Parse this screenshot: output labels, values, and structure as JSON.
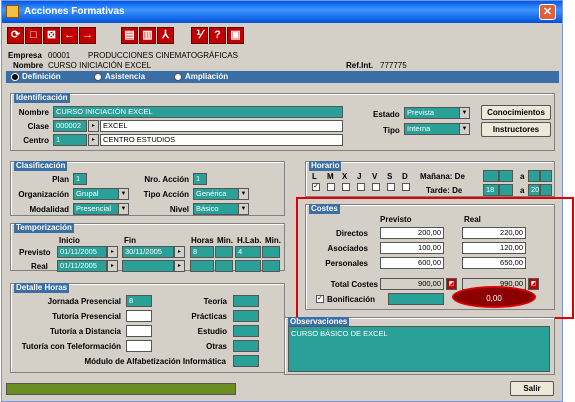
{
  "window": {
    "title": "Acciones Formativas"
  },
  "toolbar": [
    "⟳",
    "□",
    "⊠",
    "←",
    "→",
    "▤",
    "▥",
    "⅄",
    "⅟",
    "?",
    "▣"
  ],
  "header": {
    "empresa_label": "Empresa",
    "empresa_code": "00001",
    "empresa_name": "PRODUCCIONES CINEMATOGRÁFICAS",
    "nombre_label": "Nombre",
    "nombre_value": "CURSO INICIACIÓN EXCEL",
    "ref_label": "Ref.Int.",
    "ref_value": "777775"
  },
  "tabs": [
    "Definición",
    "Asistencia",
    "Ampliación"
  ],
  "identificacion": {
    "title": "Identificación",
    "nombre_label": "Nombre",
    "nombre": "CURSO INICIACIÓN EXCEL",
    "clase_label": "Clase",
    "clase_code": "000002",
    "clase_name": "EXCEL",
    "centro_label": "Centro",
    "centro_code": "1",
    "centro_name": "CENTRO ESTUDIOS",
    "estado_label": "Estado",
    "estado": "Prevista",
    "tipo_label": "Tipo",
    "tipo": "Interna",
    "btn_conocimientos": "Conocimientos",
    "btn_instructores": "Instructores"
  },
  "clasificacion": {
    "title": "Clasificación",
    "plan_label": "Plan",
    "plan": "1",
    "nro_label": "Nro. Acción",
    "nro": "1",
    "org_label": "Organización",
    "org": "Grupal",
    "tipo_label": "Tipo Acción",
    "tipo": "Genérica",
    "mod_label": "Modalidad",
    "mod": "Presencial",
    "nivel_label": "Nivel",
    "nivel": "Básico"
  },
  "horario": {
    "title": "Horario",
    "days": [
      "L",
      "M",
      "X",
      "J",
      "V",
      "S",
      "D"
    ],
    "checked_index": 0,
    "manana_label": "Mañana: De",
    "a_label": "a",
    "tarde_label": "Tarde: De",
    "tarde_de": "18",
    "tarde_a": "20"
  },
  "temporizacion": {
    "title": "Temporización",
    "cols": [
      "Inicio",
      "Fin",
      "Horas",
      "Min.",
      "H.Lab.",
      "Min."
    ],
    "previsto_label": "Previsto",
    "real_label": "Real",
    "prev_inicio": "01/11/2005",
    "prev_fin": "30/11/2005",
    "prev_horas": "8",
    "prev_hlab": "4",
    "real_inicio": "01/11/2005"
  },
  "costes": {
    "title": "Costes",
    "col_previsto": "Previsto",
    "col_real": "Real",
    "rows": [
      {
        "label": "Directos",
        "previsto": "200,00",
        "real": "220,00"
      },
      {
        "label": "Asociados",
        "previsto": "100,00",
        "real": "120,00"
      },
      {
        "label": "Personales",
        "previsto": "600,00",
        "real": "650,00"
      }
    ],
    "total_label": "Total Costes",
    "total_previsto": "900,00",
    "total_real": "990,00",
    "bonif_label": "Bonificación",
    "bonif_real": "0,00"
  },
  "detalle": {
    "title": "Detalle Horas",
    "left": [
      "Jornada Presencial",
      "Tutoría Presencial",
      "Tutoría a Distancia",
      "Tutoría con Teleformación",
      "Módulo de Alfabetización Informática"
    ],
    "jornada_value": "8",
    "right": [
      "Teoría",
      "Prácticas",
      "Estudio",
      "Otras"
    ]
  },
  "observaciones": {
    "title": "Observaciones",
    "text": "CURSO BÁSICO DE EXCEL"
  },
  "footer": {
    "salir": "Salir"
  },
  "colors": {
    "field": "#2aa198",
    "group_title": "#3a6ea5",
    "highlight": "#e00000",
    "bonif": "#8b0000"
  }
}
